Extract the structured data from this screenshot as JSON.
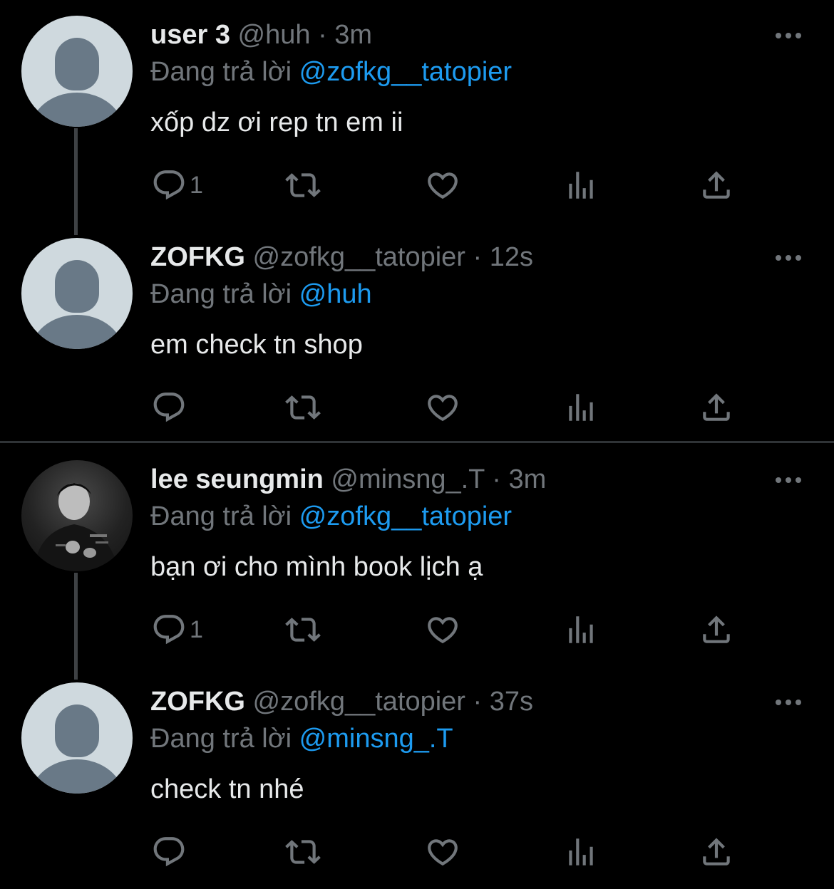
{
  "replying_label": "Đang trả lời",
  "tweets": [
    {
      "name": "user 3",
      "handle": "@huh",
      "sep": "·",
      "time": "3m",
      "reply_to": "@zofkg__tatopier",
      "text": "xốp dz ơi rep tn em ii",
      "reply_count": "1",
      "avatar": "default-avatar-icon"
    },
    {
      "name": "ZOFKG",
      "handle": "@zofkg__tatopier",
      "sep": "·",
      "time": "12s",
      "reply_to": "@huh",
      "text": "em check tn shop",
      "reply_count": "",
      "avatar": "default-avatar-icon"
    },
    {
      "name": "lee seungmin",
      "handle": "@minsng_.T",
      "sep": "·",
      "time": "3m",
      "reply_to": "@zofkg__tatopier",
      "text": "bạn ơi cho mình book lịch ạ",
      "reply_count": "1",
      "avatar": "profile-photo"
    },
    {
      "name": "ZOFKG",
      "handle": "@zofkg__tatopier",
      "sep": "·",
      "time": "37s",
      "reply_to": "@minsng_.T",
      "text": "check tn nhé",
      "reply_count": "",
      "avatar": "default-avatar-icon"
    }
  ],
  "icons": [
    "reply-icon",
    "retweet-icon",
    "like-icon",
    "views-icon",
    "share-icon",
    "more-icon"
  ],
  "colors": {
    "background": "#000000",
    "text": "#e7e9ea",
    "secondary": "#71767b",
    "mention": "#1d9bf0",
    "default_avatar_bg": "#cfd9de",
    "default_avatar_fg": "#697987"
  }
}
